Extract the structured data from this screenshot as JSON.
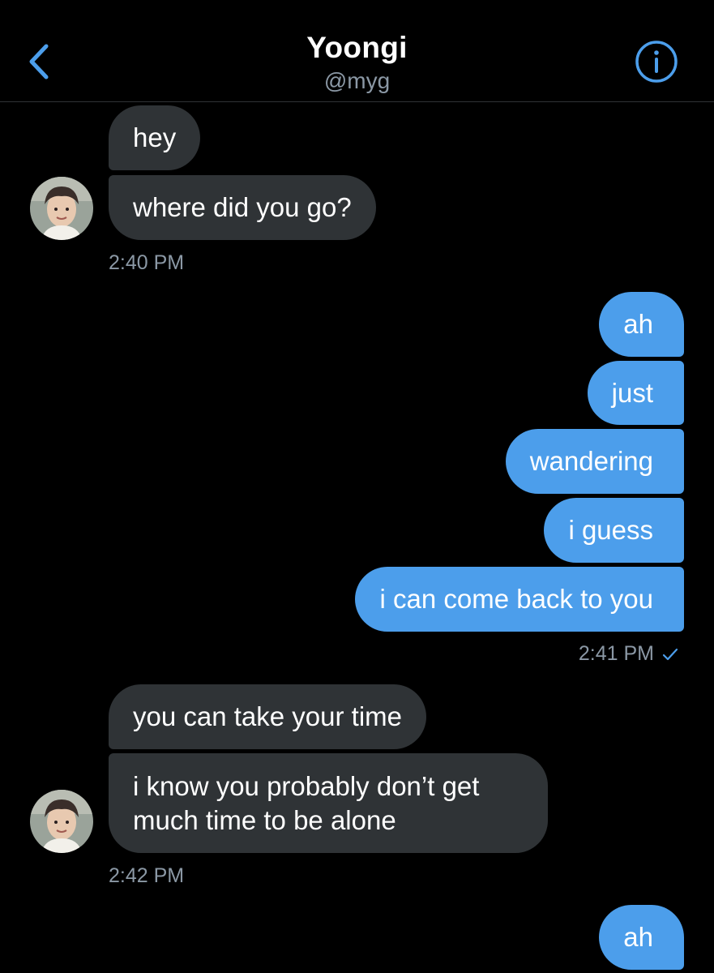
{
  "header": {
    "title": "Yoongi",
    "subtitle": "@myg",
    "back_icon": "chevron-left-icon",
    "info_icon": "info-circle-icon"
  },
  "colors": {
    "background": "#000000",
    "incoming_bubble": "#2f3336",
    "outgoing_bubble": "#4c9eeb",
    "accent": "#4c9eeb",
    "muted_text": "#8b98a5"
  },
  "messages": [
    {
      "text": "hey"
    },
    {
      "text": "where did you go?"
    },
    {
      "time": "2:40 PM"
    },
    {
      "text": "ah"
    },
    {
      "text": "just"
    },
    {
      "text": "wandering"
    },
    {
      "text": "i guess"
    },
    {
      "text": "i can come back to you"
    },
    {
      "time": "2:41 PM"
    },
    {
      "text": "you can take your time"
    },
    {
      "text": "i know you probably don’t get much time to be alone"
    },
    {
      "time": "2:42 PM"
    },
    {
      "text": "ah"
    }
  ]
}
